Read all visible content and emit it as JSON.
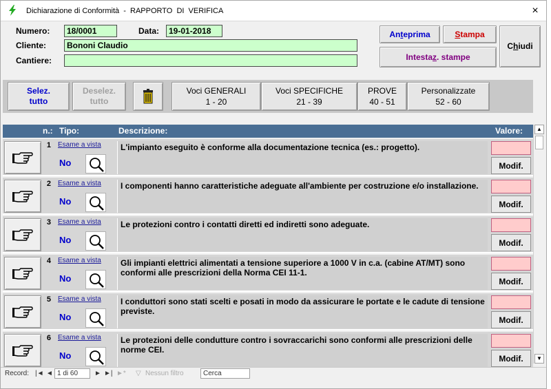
{
  "window": {
    "title": "Dichiarazione di Conformità  -  RAPPORTO  DI  VERIFICA",
    "close": "×"
  },
  "form": {
    "numero_label": "Numero:",
    "numero_value": "18/0001",
    "data_label": "Data:",
    "data_value": "19-01-2018",
    "cliente_label": "Cliente:",
    "cliente_value": "Bononi Claudio",
    "cantiere_label": "Cantiere:",
    "cantiere_value": ""
  },
  "actions": {
    "anteprima_a": "An",
    "anteprima_b": "t",
    "anteprima_c": "eprima",
    "stampa_a": "",
    "stampa_b": "S",
    "stampa_c": "tampa",
    "intestaz_a": "Intesta",
    "intestaz_b": "z",
    "intestaz_c": ". stampe",
    "chiudi_a": "C",
    "chiudi_b": "h",
    "chiudi_c": "iudi",
    "colors": {
      "anteprima": "#0000cc",
      "stampa": "#cc0000",
      "intestaz": "#800080"
    }
  },
  "toolbar": {
    "selez_line1": "Selez.",
    "selez_line2": "tutto",
    "deselez_line1": "Deselez.",
    "deselez_line2": "tutto",
    "trash_icon": "trash-icon",
    "tabs": [
      {
        "line1": "Voci GENERALI",
        "line2": "1 - 20"
      },
      {
        "line1": "Voci SPECIFICHE",
        "line2": "21 - 39"
      },
      {
        "line1": "PROVE",
        "line2": "40 - 51"
      },
      {
        "line1": "Personalizzate",
        "line2": "52 - 60"
      }
    ]
  },
  "table": {
    "headers": {
      "n": "n.:",
      "tipo": "Tipo:",
      "descrizione": "Descrizione:",
      "valore": "Valore:"
    },
    "modif_label": "Modif.",
    "rows": [
      {
        "n": "1",
        "tipo": "Esame a vista",
        "esito": "No",
        "descrizione": "L'impianto eseguito è conforme alla documentazione tecnica (es.: progetto)."
      },
      {
        "n": "2",
        "tipo": "Esame a vista",
        "esito": "No",
        "descrizione": "I componenti hanno caratteristiche adeguate all'ambiente per costruzione e/o installazione."
      },
      {
        "n": "3",
        "tipo": "Esame a vista",
        "esito": "No",
        "descrizione": "Le protezioni contro i contatti diretti ed indiretti sono adeguate."
      },
      {
        "n": "4",
        "tipo": "Esame a vista",
        "esito": "No",
        "descrizione": "Gli impianti elettrici alimentati a tensione superiore a 1000 V in c.a. (cabine AT/MT) sono conformi alle prescrizioni della Norma CEI 11-1."
      },
      {
        "n": "5",
        "tipo": "Esame a vista",
        "esito": "No",
        "descrizione": "I conduttori sono stati scelti e posati in modo da assicurare le portate e le cadute di tensione previste."
      },
      {
        "n": "6",
        "tipo": "Esame a vista",
        "esito": "No",
        "descrizione": "Le protezioni delle condutture contro i sovraccarichi sono conformi alle prescrizioni delle norme CEI."
      }
    ]
  },
  "status": {
    "record_label": "Record:",
    "record_value": "1 di 60",
    "filter": "Nessun filtro",
    "search": "Cerca"
  }
}
